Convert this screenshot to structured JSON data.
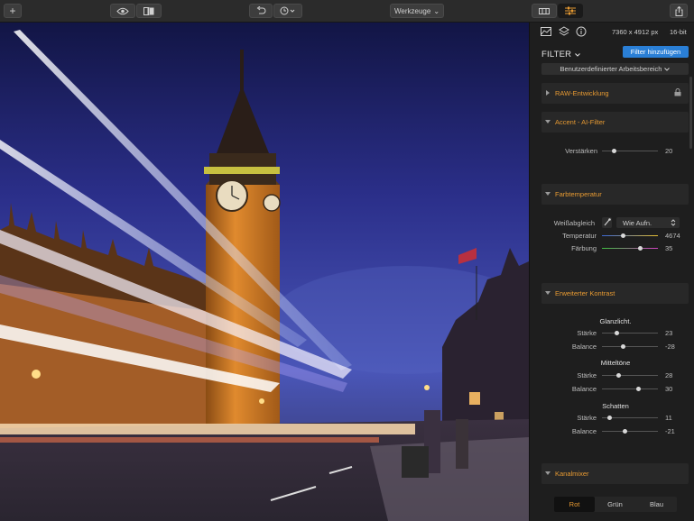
{
  "toolbar": {
    "add_label": "+",
    "tools_label": "Werkzeuge",
    "tools_chevron": "⌄"
  },
  "info": {
    "dimensions": "7360 x 4912 px",
    "bitdepth": "16-bit"
  },
  "panel": {
    "filter_title": "FILTER",
    "add_filter": "Filter hinzufügen",
    "workspace": "Benutzerdefinierter Arbeitsbereich"
  },
  "sections": {
    "raw": "RAW-Entwicklung",
    "accent": "Accent - AI-Filter",
    "farb": "Farbtemperatur",
    "kontrast": "Erweiterter Kontrast",
    "kanal": "Kanalmixer"
  },
  "accent": {
    "label": "Verstärken",
    "value": "20",
    "level": 20
  },
  "farb": {
    "wb_label": "Weißabgleich",
    "wb_value": "Wie Aufn.",
    "temp_label": "Temperatur",
    "temp_value": "4674",
    "tint_label": "Färbung",
    "tint_value": "35"
  },
  "kontrast": {
    "glanz": "Glanzlicht.",
    "mittel": "Mitteltöne",
    "schatten": "Schatten",
    "staerke": "Stärke",
    "balance": "Balance",
    "glanz_staerke": "23",
    "glanz_balance": "-28",
    "mittel_staerke": "28",
    "mittel_balance": "30",
    "schatten_staerke": "11",
    "schatten_balance": "-21"
  },
  "kanal": {
    "tabs": [
      "Rot",
      "Grün",
      "Blau"
    ],
    "active": "Rot"
  },
  "colors": {
    "accent": "#e79a32",
    "button": "#2a7fd6"
  },
  "icons": [
    "plus-icon",
    "eye-icon",
    "compare-icon",
    "undo-icon",
    "history-icon",
    "grid-icon",
    "sliders-icon",
    "share-icon",
    "histogram-icon",
    "layers-icon",
    "info-icon",
    "lock-icon",
    "eyedropper-icon"
  ]
}
